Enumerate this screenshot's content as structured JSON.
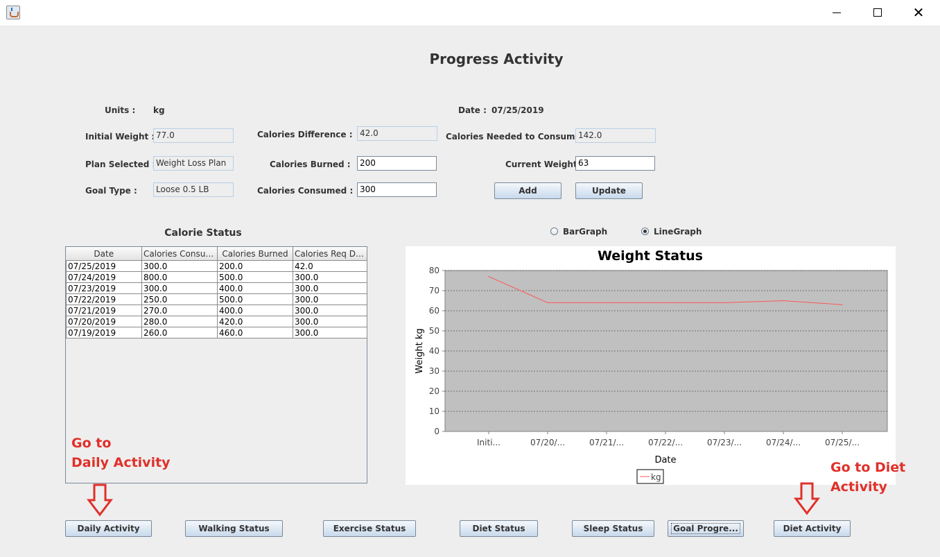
{
  "window": {
    "close_glyph": "✕"
  },
  "title": "Progress Activity",
  "form": {
    "units_label": "Units :",
    "units_value": "kg",
    "date_label": "Date :",
    "date_value": "07/25/2019",
    "initial_weight_label": "Initial Weight :",
    "initial_weight_value": "77.0",
    "plan_label": "Plan Selected :",
    "plan_value": "Weight Loss Plan",
    "goal_type_label": "Goal Type :",
    "goal_type_value": "Loose 0.5 LB",
    "calories_diff_label": "Calories Difference :",
    "calories_diff_value": "42.0",
    "calories_burned_label": "Calories Burned :",
    "calories_burned_value": "200",
    "calories_consumed_label": "Calories Consumed :",
    "calories_consumed_value": "300",
    "calories_needed_label": "Calories Needed to Consumed :",
    "calories_needed_value": "142.0",
    "current_weight_label": "Current Weight :",
    "current_weight_value": "63",
    "add_label": "Add",
    "update_label": "Update"
  },
  "calorie_status": {
    "title": "Calorie Status",
    "columns": [
      "Date",
      "Calories Consum...",
      "Calories Burned",
      "Calories Req Diff..."
    ],
    "rows": [
      [
        "07/25/2019",
        "300.0",
        "200.0",
        "42.0"
      ],
      [
        "07/24/2019",
        "800.0",
        "500.0",
        "300.0"
      ],
      [
        "07/23/2019",
        "300.0",
        "400.0",
        "300.0"
      ],
      [
        "07/22/2019",
        "250.0",
        "500.0",
        "300.0"
      ],
      [
        "07/21/2019",
        "270.0",
        "400.0",
        "300.0"
      ],
      [
        "07/20/2019",
        "280.0",
        "420.0",
        "300.0"
      ],
      [
        "07/19/2019",
        "260.0",
        "460.0",
        "300.0"
      ]
    ]
  },
  "graph_options": {
    "bar_label": "BarGraph",
    "line_label": "LineGraph",
    "selected": "LineGraph"
  },
  "chart_data": {
    "type": "line",
    "title": "Weight Status",
    "xlabel": "Date",
    "ylabel": "Weight kg",
    "categories": [
      "Initi...",
      "07/20/...",
      "07/21/...",
      "07/22/...",
      "07/23/...",
      "07/24/...",
      "07/25/..."
    ],
    "series": [
      {
        "name": "kg",
        "values": [
          77,
          64,
          64,
          64,
          64,
          65,
          63
        ],
        "color": "#ff5555"
      }
    ],
    "ylim": [
      0,
      80
    ],
    "yticks": [
      0,
      10,
      20,
      30,
      40,
      50,
      60,
      70,
      80
    ],
    "grid": true,
    "plot_background": "#c0c0c0",
    "legend": "bottom"
  },
  "annotations": {
    "daily_line1": "Go to",
    "daily_line2": "Daily Activity",
    "diet_line1": "Go to Diet",
    "diet_line2": "Activity"
  },
  "nav_buttons": [
    "Daily Activity",
    "Walking Status",
    "Exercise Status",
    "Diet Status",
    "Sleep Status",
    "Goal Progre...",
    "Diet Activity"
  ],
  "colors": {
    "annotation": "#e0302a",
    "series": "#ff5555"
  }
}
